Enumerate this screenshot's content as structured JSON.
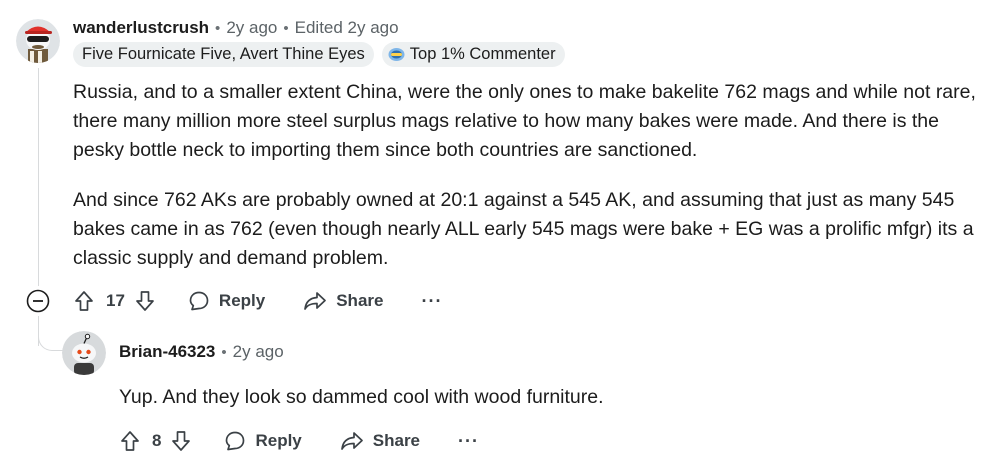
{
  "comments": [
    {
      "username": "wanderlustcrush",
      "time": "2y ago",
      "edited": "Edited 2y ago",
      "flair_text": "Five Fournicate Five, Avert Thine Eyes",
      "badge_text": "Top 1% Commenter",
      "paragraphs": [
        "Russia, and to a smaller extent China, were the only ones to make bakelite 762 mags and while not rare, there many million more steel surplus mags relative to how many bakes were made. And there is the pesky bottle neck to importing them since both countries are sanctioned.",
        "And since 762 AKs are probably owned at 20:1 against a 545 AK, and assuming that just as many 545 bakes came in as 762 (even though nearly ALL early 545 mags were bake + EG was a prolific mfgr) its a classic supply and demand problem."
      ],
      "votes": "17",
      "reply_label": "Reply",
      "share_label": "Share",
      "more_label": "···"
    },
    {
      "username": "Brian-46323",
      "time": "2y ago",
      "paragraphs": [
        "Yup. And they look so dammed cool with wood furniture."
      ],
      "votes": "8",
      "reply_label": "Reply",
      "share_label": "Share",
      "more_label": "···"
    }
  ],
  "dot_separator": "•",
  "colors": {
    "text": "#1c1c1c",
    "meta": "#5c6367",
    "flair_bg": "#edf0f1",
    "thread_line": "#d8dadc"
  }
}
